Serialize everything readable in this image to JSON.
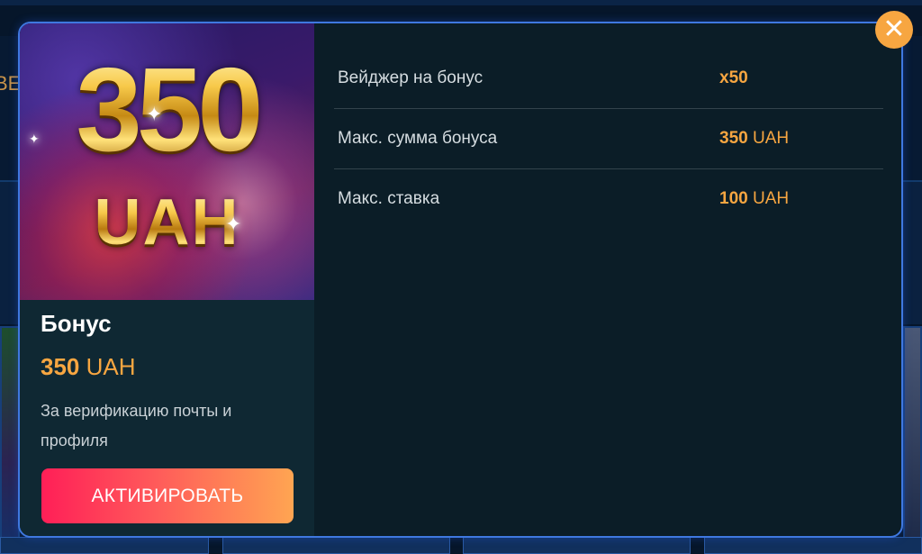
{
  "background": {
    "partial_text": "ВЕ"
  },
  "bonus": {
    "banner_number": "350",
    "banner_currency": "UAH",
    "title": "Бонус",
    "amount_value": "350",
    "amount_currency": "UAH",
    "description": "За верификацию почты и профиля",
    "activate_label": "АКТИВИРОВАТЬ"
  },
  "details": [
    {
      "label": "Вейджер на бонус",
      "value": "x50",
      "currency": ""
    },
    {
      "label": "Макс. сумма бонуса",
      "value": "350",
      "currency": "UAH"
    },
    {
      "label": "Макс. ставка",
      "value": "100",
      "currency": "UAH"
    }
  ],
  "close": {
    "symbol": "✕"
  },
  "colors": {
    "accent": "#f7a641",
    "modal_border": "#3f78e0",
    "button_gradient_start": "#ff1f57",
    "button_gradient_end": "#ffa552"
  }
}
